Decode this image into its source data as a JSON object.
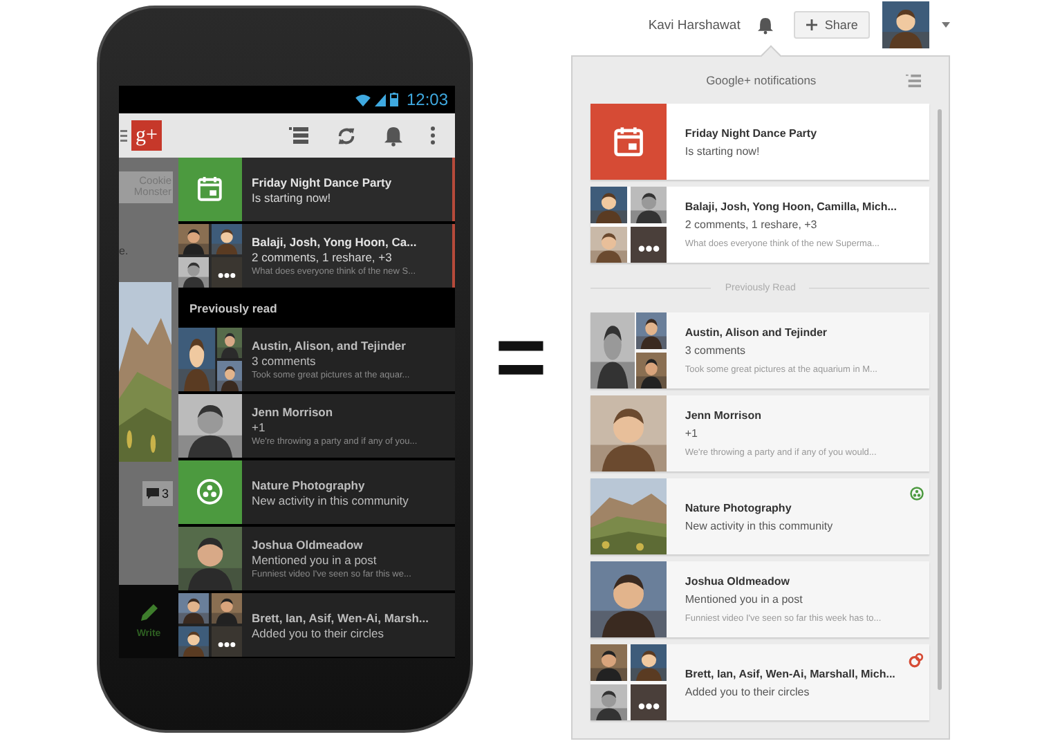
{
  "phone": {
    "status_time": "12:03",
    "logo": "g+",
    "background_page": {
      "lines": [
        "Cookie",
        "Monster"
      ],
      "fragment": "e.",
      "comment_count": "3",
      "write_label": "Write"
    },
    "notifications": {
      "unread": [
        {
          "kind": "event",
          "title": "Friday Night Dance Party",
          "subtitle": "Is starting now!"
        },
        {
          "kind": "collage",
          "title": "Balaji, Josh, Yong Hoon, Ca...",
          "subtitle": "2 comments, 1 reshare, +3",
          "snippet": "What does everyone think of the new S..."
        }
      ],
      "read_heading": "Previously read",
      "read": [
        {
          "kind": "trio",
          "title": "Austin, Alison, and Tejinder",
          "subtitle": "3 comments",
          "snippet": "Took some great pictures at the aquar..."
        },
        {
          "title": "Jenn Morrison",
          "subtitle": "+1",
          "snippet": "We're throwing a party and if any of you..."
        },
        {
          "kind": "community",
          "title": "Nature Photography",
          "subtitle": "New activity in this community"
        },
        {
          "title": "Joshua Oldmeadow",
          "subtitle": "Mentioned you in a post",
          "snippet": "Funniest video I've seen so far this we..."
        },
        {
          "kind": "collage",
          "title": "Brett, Ian, Asif, Wen-Ai, Marsh...",
          "subtitle": "Added you to their circles"
        }
      ]
    }
  },
  "equals": "=",
  "desktop": {
    "user_name": "Kavi Harshawat",
    "share_label": "Share",
    "panel": {
      "title": "Google+ notifications",
      "unread": [
        {
          "kind": "event",
          "title": "Friday Night Dance Party",
          "subtitle": "Is starting now!"
        },
        {
          "kind": "collage",
          "title": "Balaji, Josh, Yong Hoon, Camilla, Mich...",
          "subtitle": "2 comments, 1 reshare, +3",
          "snippet": "What does everyone think of the new Superma..."
        }
      ],
      "read_heading": "Previously Read",
      "read": [
        {
          "kind": "trio",
          "title": "Austin, Alison and Tejinder",
          "subtitle": "3 comments",
          "snippet": "Took some great pictures at the aquarium in M..."
        },
        {
          "title": "Jenn Morrison",
          "subtitle": "+1",
          "snippet": "We're throwing a party and if any of you would..."
        },
        {
          "kind": "landscape",
          "title": "Nature Photography",
          "subtitle": "New activity in this community",
          "badge": {
            "kind": "community"
          }
        },
        {
          "title": "Joshua Oldmeadow",
          "subtitle": "Mentioned you in a post",
          "snippet": "Funniest video I've seen so far this week has to..."
        },
        {
          "kind": "collage",
          "title": "Brett, Ian, Asif, Wen-Ai, Marshall, Mich...",
          "subtitle": "Added you to their circles",
          "badge": {
            "kind": "circles"
          }
        }
      ]
    }
  }
}
